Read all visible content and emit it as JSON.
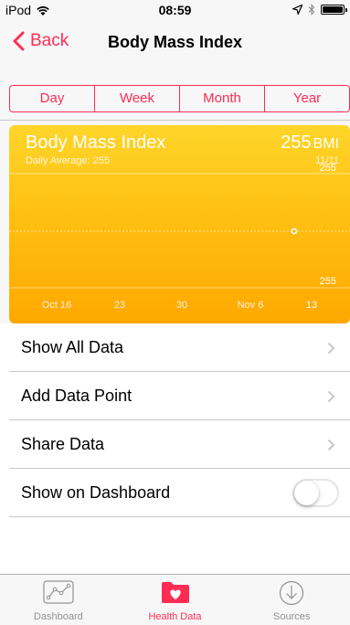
{
  "status_bar": {
    "carrier": "iPod",
    "time": "08:59"
  },
  "nav": {
    "back_label": "Back",
    "title": "Body Mass Index"
  },
  "segments": [
    {
      "label": "Day",
      "active": false
    },
    {
      "label": "Week",
      "active": false
    },
    {
      "label": "Month",
      "active": true
    },
    {
      "label": "Year",
      "active": false
    }
  ],
  "card": {
    "title": "Body Mass Index",
    "subtitle": "Daily Average: 255",
    "value": "255",
    "unit": "BMI",
    "date": "11/11"
  },
  "chart_data": {
    "type": "scatter",
    "x": [
      "11/11"
    ],
    "y": [
      255
    ],
    "x_tick_labels": [
      "Oct 16",
      "23",
      "30",
      "Nov 6",
      "13"
    ],
    "y_tick_labels": [
      "255",
      "255"
    ],
    "ylim": [
      255,
      255
    ],
    "grid": true
  },
  "list": {
    "items": [
      {
        "label": "Show All Data"
      },
      {
        "label": "Add Data Point"
      },
      {
        "label": "Share Data"
      }
    ],
    "dashboard": {
      "label": "Show on Dashboard",
      "on": false
    }
  },
  "tabs": [
    {
      "label": "Dashboard",
      "icon": "dashboard-icon",
      "active": false
    },
    {
      "label": "Health Data",
      "icon": "health-data-icon",
      "active": true
    },
    {
      "label": "Sources",
      "icon": "sources-icon",
      "active": false
    }
  ],
  "colors": {
    "accent": "#ff2d55",
    "card_top": "#ffd52a",
    "card_bottom": "#ffa800"
  }
}
